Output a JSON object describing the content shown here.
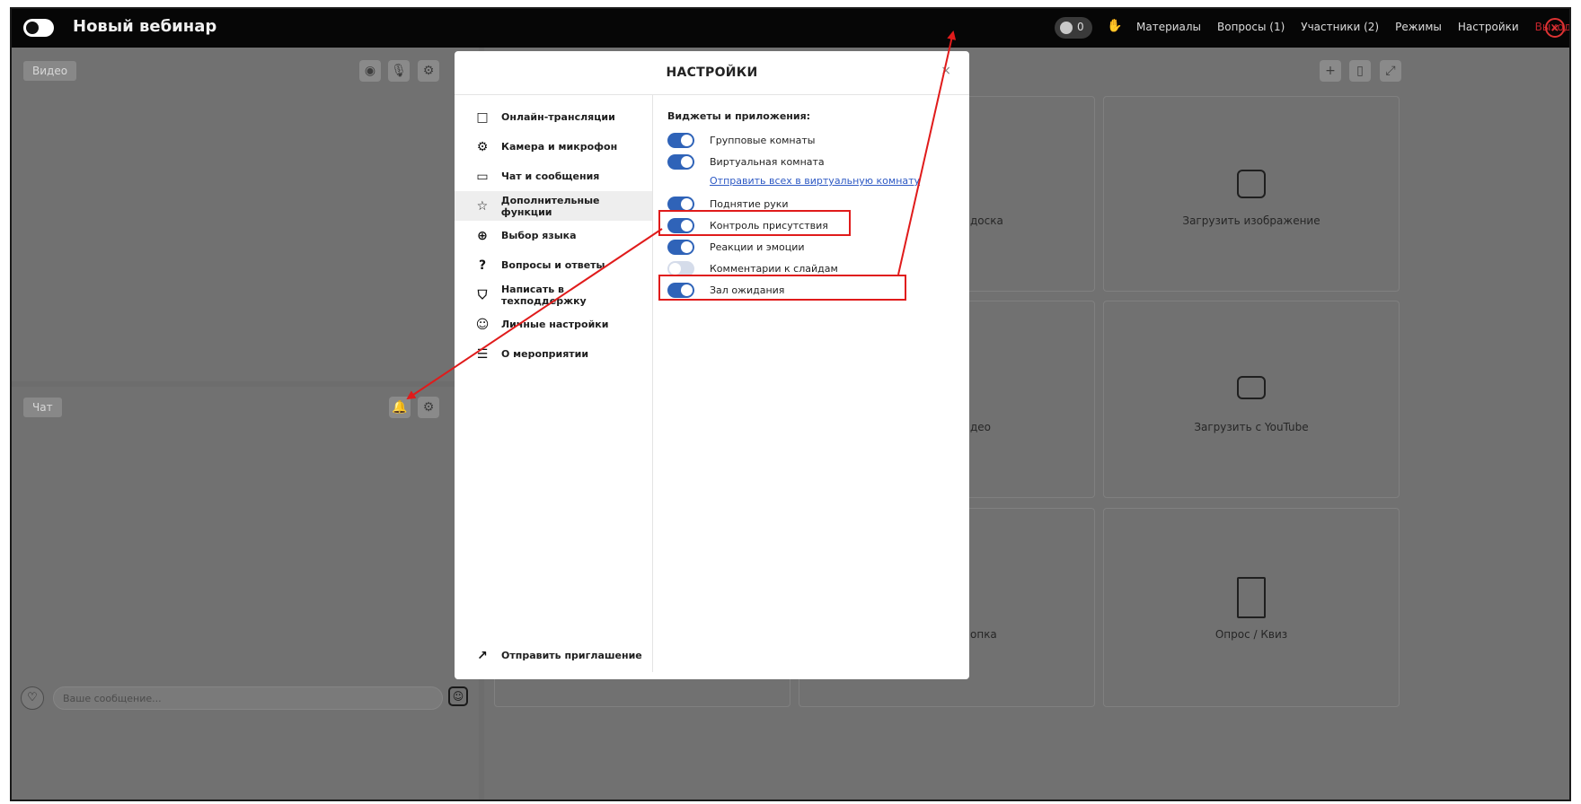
{
  "header": {
    "title": "Новый вебинар",
    "timer_count": "0",
    "nav": [
      "Материалы",
      "Вопросы (1)",
      "Участники (2)",
      "Режимы",
      "Настройки"
    ],
    "exit_label": "Выход"
  },
  "video_panel": {
    "tag": "Видео"
  },
  "chat_panel": {
    "tag": "Чат",
    "input_placeholder": "Ваше сообщение..."
  },
  "content_tiles": [
    {
      "label": "Загрузить изображение",
      "icon": "image-icon"
    },
    {
      "label": "Загрузить с YouTube",
      "icon": "youtube-icon"
    },
    {
      "label": "Опрос / Квиз",
      "icon": "trophy-icon"
    }
  ],
  "partial_tiles": [
    "доска",
    "део",
    "опка"
  ],
  "modal": {
    "title": "НАСТРОЙКИ",
    "close": "×",
    "nav": [
      {
        "label": "Онлайн-трансляции",
        "icon": "camera-icon"
      },
      {
        "label": "Камера и микрофон",
        "icon": "gear-icon"
      },
      {
        "label": "Чат и сообщения",
        "icon": "chat-icon"
      },
      {
        "label": "Дополнительные функции",
        "icon": "star-icon",
        "active": true
      },
      {
        "label": "Выбор языка",
        "icon": "globe-icon"
      },
      {
        "label": "Вопросы и ответы",
        "icon": "question-icon"
      },
      {
        "label": "Написать в техподдержку",
        "icon": "shield-icon"
      },
      {
        "label": "Личные настройки",
        "icon": "user-icon"
      },
      {
        "label": "О мероприятии",
        "icon": "list-icon"
      }
    ],
    "invite_label": "Отправить приглашение",
    "section_title": "Виджеты и приложения:",
    "options": [
      {
        "label": "Групповые комнаты",
        "on": true
      },
      {
        "label": "Виртуальная комната",
        "on": true
      },
      {
        "label": "Поднятие руки",
        "on": true
      },
      {
        "label": "Контроль присутствия",
        "on": true
      },
      {
        "label": "Реакции и эмоции",
        "on": true
      },
      {
        "label": "Комментарии к слайдам",
        "on": false
      },
      {
        "label": "Зал ожидания",
        "on": true
      }
    ],
    "virtual_room_link": "Отправить всех в виртуальную комнату"
  },
  "annotation_color": "#e01b1b",
  "toggle_on_color": "#2f63b8"
}
